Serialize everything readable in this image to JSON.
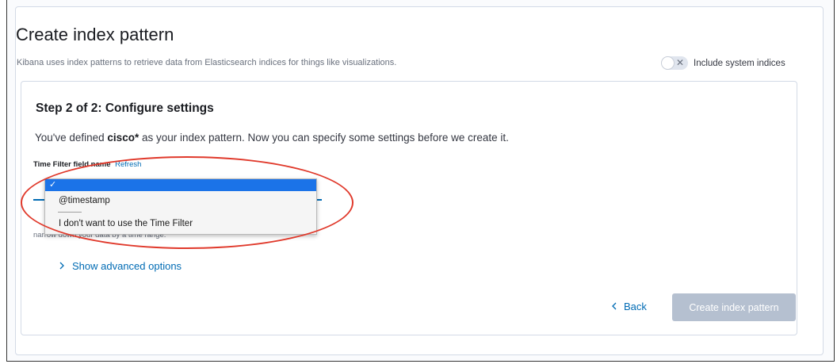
{
  "header": {
    "title": "Create index pattern",
    "subtitle": "Kibana uses index patterns to retrieve data from Elasticsearch indices for things like visualizations.",
    "system_toggle": {
      "label": "Include system indices",
      "checked": false
    }
  },
  "step": {
    "title": "Step 2 of 2: Configure settings",
    "desc_prefix": "You've defined ",
    "pattern": "cisco*",
    "desc_suffix": " as your index pattern. Now you can specify some settings before we create it."
  },
  "time_field": {
    "label": "Time Filter field name",
    "refresh": "Refresh",
    "help_text": "narrow down your data by a time range.",
    "selected_mark": "✓",
    "options": [
      "@timestamp",
      "I don't want to use the Time Filter"
    ]
  },
  "advanced": {
    "label": "Show advanced options"
  },
  "footer": {
    "back": "Back",
    "create": "Create index pattern"
  },
  "colors": {
    "link": "#006bb4",
    "annotation": "#e0392b",
    "disabled_button": "#b5c0d0",
    "dropdown_highlight": "#1b73e8"
  }
}
